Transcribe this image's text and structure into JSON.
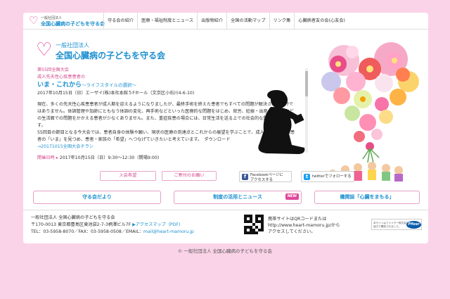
{
  "nav": {
    "logo_small": "一般社団法人",
    "logo_big": "全国心臓病の子どもを守る会",
    "items": [
      "守る会の紹介",
      "医療・福祉制度とニュース",
      "出版物紹介",
      "全国の活動マップ",
      "リンク集",
      "心臓病者友の会(心友会)"
    ]
  },
  "brand": {
    "small": "一般社団法人",
    "big": "全国心臓病の子どもを守る会"
  },
  "news": {
    "line1": "第55回全国大会",
    "line2": "成人先天性心疾患患者の",
    "title": "いま・これから",
    "subtitle": "〜ライフスタイルの選択〜",
    "date_venue": "2017年10月15日（日）エーザイ(株)本社本館５Fホール（文京区小石川4-6-10)",
    "body1": "現在、多くの先天性心疾患患者が成人期を迎えるようになりましたが、最終手術を終えた患者でもすべての問題が解決されるわけではありません。体調管理や加齢にともなう体調の変化、再手術などといった医療的な問題をはじめ、就労、妊娠・出産・子育てなどの生活面での問題をかかえる患者が少なくありません。また、重症疾患の場合には、日常生活を送る上での社会的な問題もあります。",
    "body2": "55回目の節目となる今大会では、患者自身の体験や願い、現状の医療の到達点とこれからの展望を学ぶことで、成人先天性心疾患患者の「いま」を見つめ、患者・家族の「希望」へつなげていきたいと考えています。　ダウンロード",
    "flyer_link": "→20171015全国大会チラシ",
    "schedule_label": "開催日時",
    "schedule_value": "2017年10月15日（日）9:30〜12:30（開場9:00)"
  },
  "actions": {
    "join": "入会希望",
    "donate": "ご寄付のお願い",
    "facebook_line1": "Facebookページに",
    "facebook_line2": "アクセスする",
    "twitter": "twitterでフォローする"
  },
  "sections": {
    "newsletter": "守る会だより",
    "system": "制度の活用とニュース",
    "new_badge": "NEW",
    "journal": "機関誌「心臓をまもる」"
  },
  "footer": {
    "org": "一般社団法人 全国心臓病の子どもを守る会",
    "address": "〒170-0013 東京都豊島区東池袋2-7-3柄澤ビル7F",
    "access": "▶アクセスマップ（PDF)",
    "tel": "TEL：03-5958-8070／FAX：03-5958-0508／EMAIL：",
    "email": "mail@heart-mamoru.jp",
    "qr_line1": "携帯サイトはQRコードまたは",
    "qr_line2": "http://www.heart-mamoru.jp/から",
    "qr_line3": "アクセスしてください。",
    "sponsor_line1": "本サイトはファイザー株式会社の",
    "sponsor_line2": "協力で開設されました。",
    "sponsor_logo": "Pfizer"
  },
  "copyright": "© 一般社団法人 全国心臓病の子どもを守る会",
  "colors": {
    "background": "#fbd3e8",
    "accent_pink": "#e0489a",
    "accent_blue": "#1d8fcf"
  }
}
